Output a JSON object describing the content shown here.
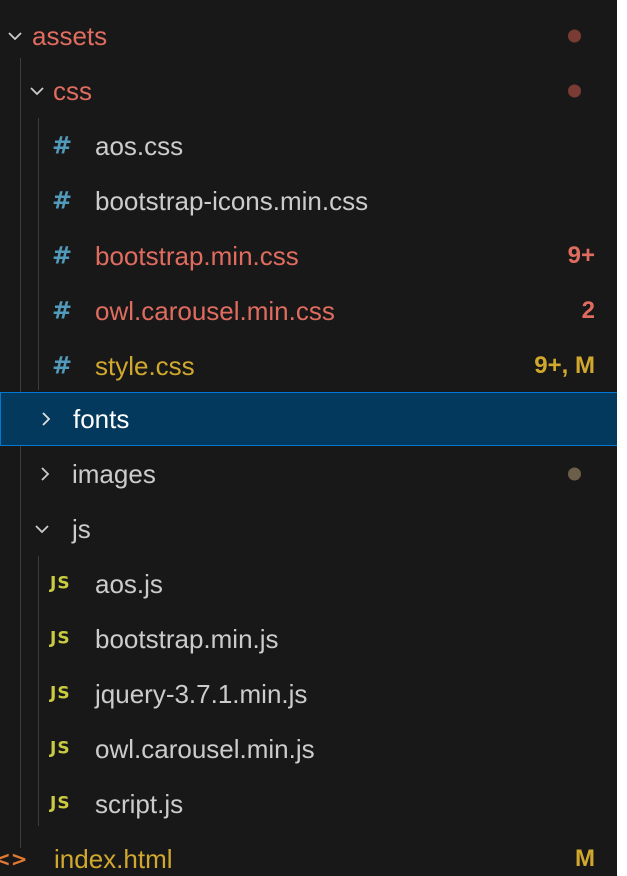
{
  "explorer": {
    "assets": {
      "label": "assets",
      "icon": "chevron-down-icon",
      "dot_color": "#7a3b34"
    },
    "css": {
      "label": "css",
      "icon": "chevron-down-icon",
      "dot_color": "#7a3b34",
      "files": [
        {
          "label": "aos.css",
          "badge": ""
        },
        {
          "label": "bootstrap-icons.min.css",
          "badge": ""
        },
        {
          "label": "bootstrap.min.css",
          "badge": "9+"
        },
        {
          "label": "owl.carousel.min.css",
          "badge": "2"
        },
        {
          "label": "style.css",
          "badge": "9+, M"
        }
      ]
    },
    "fonts": {
      "label": "fonts",
      "icon": "chevron-right-icon",
      "selected": true
    },
    "images": {
      "label": "images",
      "icon": "chevron-right-icon",
      "dot_color": "#6b5f4a"
    },
    "js": {
      "label": "js",
      "icon": "chevron-down-icon",
      "files": [
        {
          "label": "aos.js"
        },
        {
          "label": "bootstrap.min.js"
        },
        {
          "label": "jquery-3.7.1.min.js"
        },
        {
          "label": "owl.carousel.min.js"
        },
        {
          "label": "script.js"
        }
      ]
    },
    "index": {
      "label": "index.html",
      "badge": "M"
    },
    "icons": {
      "css_file": "#",
      "js_file": "JS",
      "html_file": "<>"
    }
  }
}
